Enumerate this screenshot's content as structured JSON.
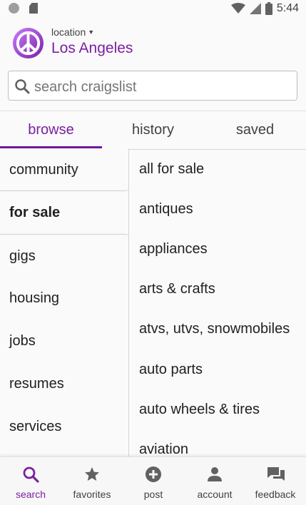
{
  "status_bar": {
    "time": "5:44"
  },
  "header": {
    "location_label": "location",
    "city": "Los Angeles"
  },
  "search": {
    "placeholder": "search craigslist"
  },
  "tabs": [
    {
      "label": "browse",
      "active": true
    },
    {
      "label": "history",
      "active": false
    },
    {
      "label": "saved",
      "active": false
    }
  ],
  "categories": [
    {
      "label": "community"
    },
    {
      "label": "for sale",
      "selected": true
    },
    {
      "label": "gigs"
    },
    {
      "label": "housing"
    },
    {
      "label": "jobs"
    },
    {
      "label": "resumes"
    },
    {
      "label": "services"
    }
  ],
  "subcategories": [
    "all for sale",
    "antiques",
    "appliances",
    "arts & crafts",
    "atvs, utvs, snowmobiles",
    "auto parts",
    "auto wheels & tires",
    "aviation"
  ],
  "bottom_nav": [
    {
      "label": "search",
      "icon": "search-icon",
      "active": true
    },
    {
      "label": "favorites",
      "icon": "star-icon"
    },
    {
      "label": "post",
      "icon": "plus-circle-icon"
    },
    {
      "label": "account",
      "icon": "person-icon"
    },
    {
      "label": "feedback",
      "icon": "chat-icon"
    }
  ],
  "colors": {
    "accent": "#7b1fa2"
  }
}
